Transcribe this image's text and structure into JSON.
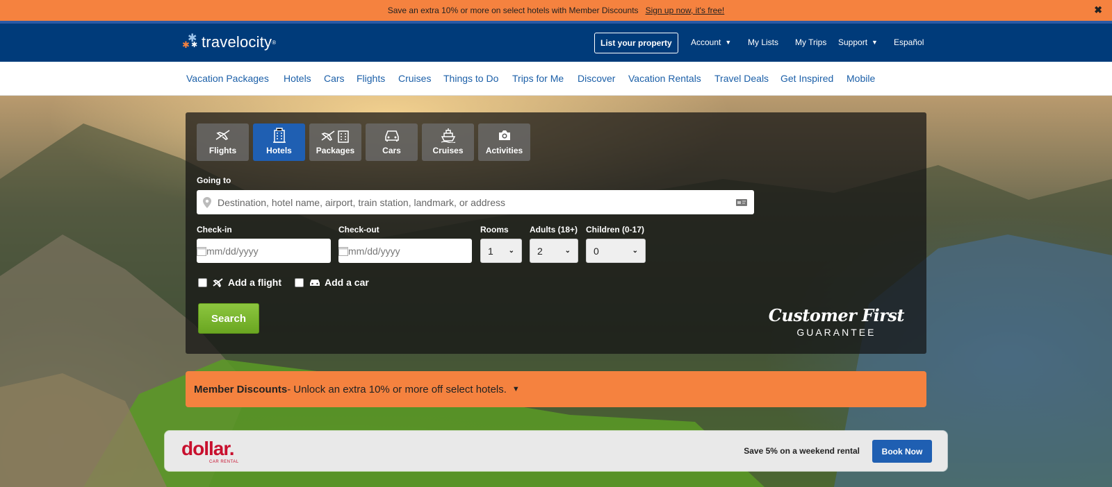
{
  "promo": {
    "text": "Save an extra 10% or more on select hotels with Member Discounts",
    "link": "Sign up now, it's free!",
    "close": "✖"
  },
  "header": {
    "logo": "travelocity",
    "logo_tm": "®",
    "list_property": "List your property",
    "account": "Account",
    "my_lists": "My Lists",
    "my_trips": "My Trips",
    "support": "Support",
    "espanol": "Español"
  },
  "subnav": [
    "Vacation Packages",
    "Hotels",
    "Cars",
    "Flights",
    "Cruises",
    "Things to Do",
    "Trips for Me",
    "Discover",
    "Vacation Rentals",
    "Travel Deals",
    "Get Inspired",
    "Mobile"
  ],
  "tabs": [
    {
      "label": "Flights",
      "icon": "plane-icon"
    },
    {
      "label": "Hotels",
      "icon": "hotel-icon",
      "active": true
    },
    {
      "label": "Packages",
      "icon": "package-icon"
    },
    {
      "label": "Cars",
      "icon": "car-icon"
    },
    {
      "label": "Cruises",
      "icon": "ship-icon"
    },
    {
      "label": "Activities",
      "icon": "camera-icon"
    }
  ],
  "form": {
    "going_to_label": "Going to",
    "destination_placeholder": "Destination, hotel name, airport, train station, landmark, or address",
    "checkin_label": "Check-in",
    "checkout_label": "Check-out",
    "date_placeholder": "mm/dd/yyyy",
    "rooms_label": "Rooms",
    "rooms_value": "1",
    "adults_label": "Adults (18+)",
    "adults_value": "2",
    "children_label": "Children (0-17)",
    "children_value": "0",
    "add_flight": "Add a flight",
    "add_car": "Add a car",
    "search_button": "Search"
  },
  "guarantee": {
    "line1": "Customer First",
    "line2": "GUARANTEE"
  },
  "member": {
    "bold": "Member Discounts",
    "text": " - Unlock an extra 10% or more off select hotels."
  },
  "ad": {
    "brand": "dollar.",
    "brand_sub": "CAR RENTAL",
    "offer": "Save 5% on a weekend rental",
    "button": "Book Now"
  },
  "colors": {
    "promo": "#f5823f",
    "header": "#003b7a",
    "accent_blue": "#1f5fb2",
    "search_green": "#7ab733",
    "dollar_red": "#c8102e"
  }
}
